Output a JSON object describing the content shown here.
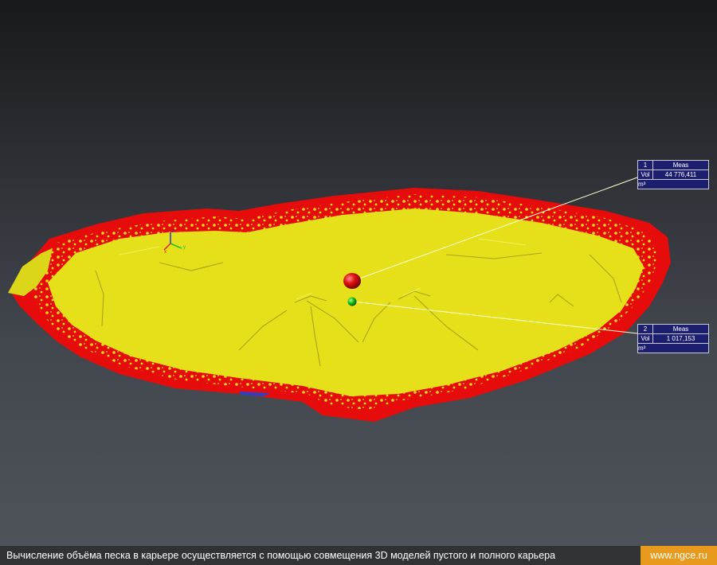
{
  "measurements": [
    {
      "id": "1",
      "label": "Meas",
      "quantity": "Vol",
      "value": "44 776,411",
      "unit": "m³"
    },
    {
      "id": "2",
      "label": "Meas",
      "quantity": "Vol",
      "value": "1 017,153",
      "unit": "m³"
    }
  ],
  "markers": [
    {
      "name": "red-sphere",
      "color": "#e01010"
    },
    {
      "name": "green-sphere",
      "color": "#10c010"
    }
  ],
  "axis_triad": {
    "x_color": "#e02020",
    "y_color": "#20c020",
    "z_color": "#3030e0"
  },
  "surface_colors": {
    "filled": "#e6e01a",
    "difference": "#e60c0c"
  },
  "caption": {
    "text": "Вычисление объёма песка в карьере осуществляется с помощью совмещения 3D моделей пустого и полного карьера",
    "link": "www.ngce.ru",
    "link_bg": "#e89a1f"
  }
}
